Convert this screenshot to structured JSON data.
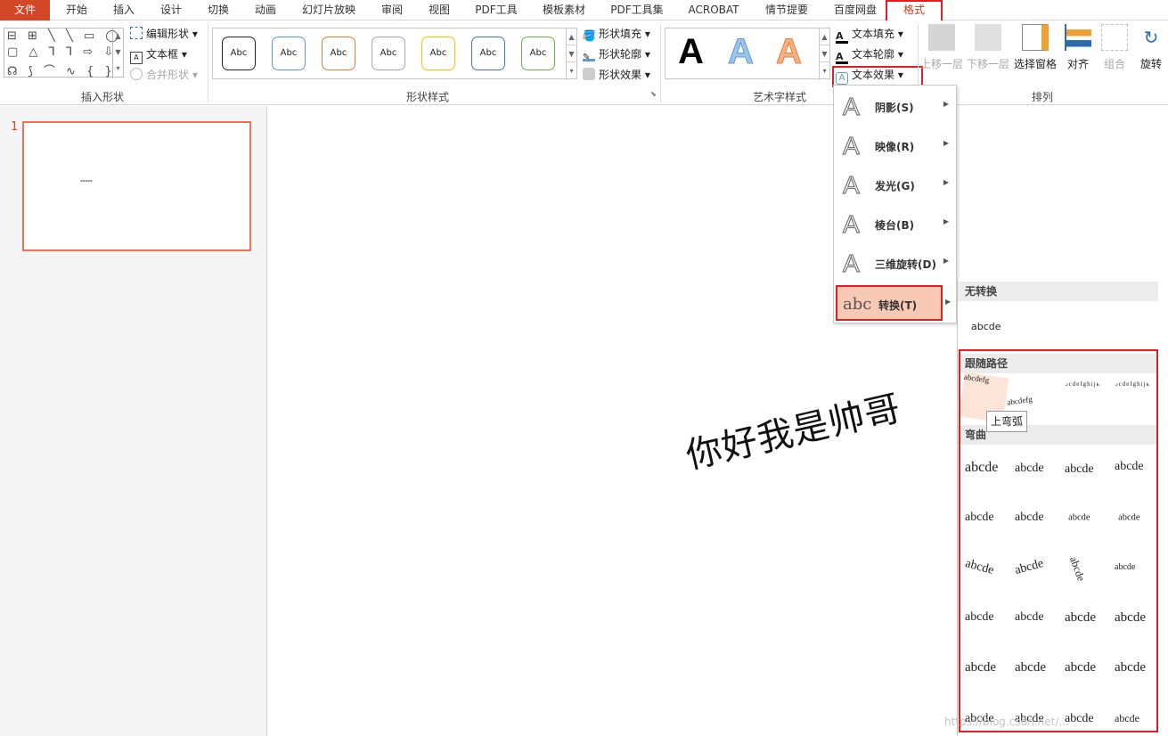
{
  "tabs": [
    "文件",
    "开始",
    "插入",
    "设计",
    "切换",
    "动画",
    "幻灯片放映",
    "审阅",
    "视图",
    "PDF工具",
    "模板素材",
    "PDF工具集",
    "ACROBAT",
    "情节提要",
    "百度网盘",
    "格式"
  ],
  "ribbon": {
    "insert_shapes": {
      "edit_shape": "编辑形状",
      "text_box": "文本框",
      "merge_shape": "合并形状",
      "label": "插入形状"
    },
    "shape_styles": {
      "preset_label": "Abc",
      "presets": [
        {
          "color": "#222222"
        },
        {
          "color": "#5b9bd5"
        },
        {
          "color": "#ed7d31"
        },
        {
          "color": "#a5a5a5"
        },
        {
          "color": "#ffc000"
        },
        {
          "color": "#4472c4"
        },
        {
          "color": "#70ad47"
        }
      ],
      "fill": "形状填充",
      "outline": "形状轮廓",
      "effects": "形状效果",
      "label": "形状样式"
    },
    "wordart": {
      "sample": "A",
      "text_fill": "文本填充",
      "text_outline": "文本轮廓",
      "text_effects": "文本效果",
      "label": "艺术字样式"
    },
    "arrange": {
      "bring_forward": "上移一层",
      "send_backward": "下移一层",
      "selection_pane": "选择窗格",
      "align": "对齐",
      "group": "组合",
      "rotate": "旋转",
      "label": "排列"
    }
  },
  "slide_panel": {
    "slide_number": "1"
  },
  "canvas": {
    "wordart_text": "你好我是帅哥"
  },
  "text_effects_menu": {
    "items": [
      {
        "label": "阴影(S)",
        "icon": "shadow-icon"
      },
      {
        "label": "映像(R)",
        "icon": "reflection-icon"
      },
      {
        "label": "发光(G)",
        "icon": "glow-icon"
      },
      {
        "label": "棱台(B)",
        "icon": "bevel-icon"
      },
      {
        "label": "三维旋转(D)",
        "icon": "3d-rotation-icon"
      },
      {
        "label": "转换(T)",
        "icon": "transform-icon"
      }
    ]
  },
  "transform_submenu": {
    "no_transform_header": "无转换",
    "no_transform_sample": "abcde",
    "follow_path_header": "跟随路径",
    "follow_path_samples": [
      "abcdefg",
      "abcdefg",
      "abcdefghijklmn",
      "abcdefghijklmnop"
    ],
    "warp_header": "弯曲",
    "warp_sample": "abcde",
    "tooltip": "上弯弧"
  },
  "watermark": "https://blog.csdn.net/..."
}
